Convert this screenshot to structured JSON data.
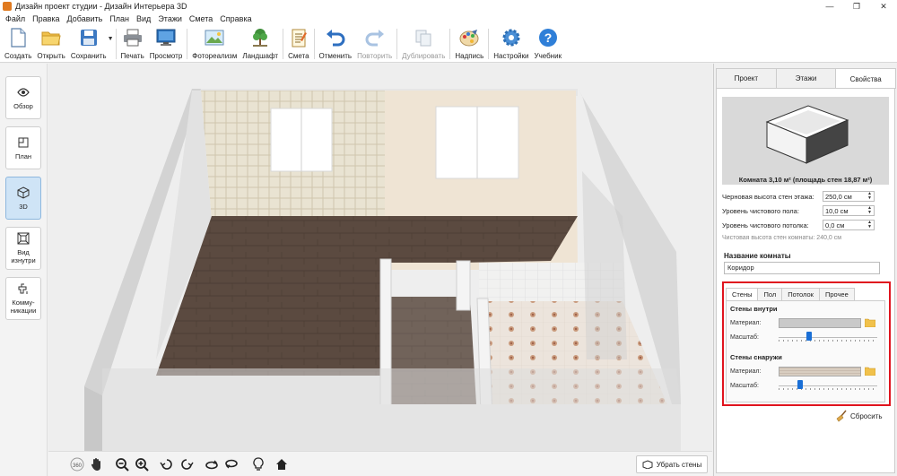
{
  "window": {
    "title": "Дизайн проект студии - Дизайн Интерьера 3D",
    "minimize": "—",
    "maximize": "❐",
    "close": "✕"
  },
  "menu": [
    "Файл",
    "Правка",
    "Добавить",
    "План",
    "Вид",
    "Этажи",
    "Смета",
    "Справка"
  ],
  "toolbar": {
    "create": "Создать",
    "open": "Открыть",
    "save": "Сохранить",
    "save_dropdown": "▼",
    "print": "Печать",
    "preview": "Просмотр",
    "photorealism": "Фотореализм",
    "landscape": "Ландшафт",
    "estimate": "Смета",
    "undo": "Отменить",
    "redo": "Повторить",
    "duplicate": "Дублировать",
    "caption": "Надпись",
    "settings": "Настройки",
    "tutorial": "Учебник"
  },
  "left_panel": {
    "overview": "Обзор",
    "plan": "План",
    "view3d": "3D",
    "inside": "Вид изнутри",
    "communications": "Комму-никации"
  },
  "bottom_bar": {
    "rotate360": "360",
    "remove_walls": "Убрать стены"
  },
  "right_panel": {
    "tabs": [
      "Проект",
      "Этажи",
      "Свойства"
    ],
    "room_caption": "Комната 3,10 м²  (площадь стен 18,87 м²)",
    "props": [
      {
        "label": "Черновая высота стен этажа:",
        "value": "250,0 см"
      },
      {
        "label": "Уровень чистового пола:",
        "value": "10,0 см"
      },
      {
        "label": "Уровень чистового потолка:",
        "value": "0,0 см"
      }
    ],
    "clean_height_note": "Чистовая высота стен комнаты: 240,0 см",
    "room_name_label": "Название комнаты",
    "room_name_value": "Коридор",
    "inner_tabs": [
      "Стены",
      "Пол",
      "Потолок",
      "Прочее"
    ],
    "walls_inside": {
      "title": "Стены внутри",
      "material_label": "Материал:",
      "scale_label": "Масштаб:",
      "scale_value": 0.3
    },
    "walls_outside": {
      "title": "Стены снаружи",
      "material_label": "Материал:",
      "scale_label": "Масштаб:",
      "scale_value": 0.2
    },
    "reset": "Сбросить"
  },
  "colors": {
    "accent": "#1a6fd6",
    "highlight_frame": "#e0141e",
    "active_tool": "#cfe4f6"
  }
}
